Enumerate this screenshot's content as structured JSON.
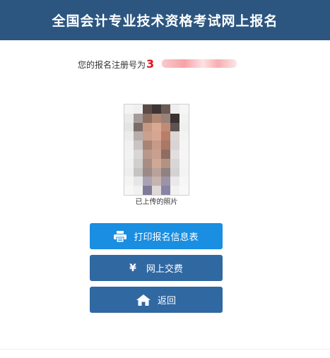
{
  "header": {
    "title": "全国会计专业技术资格考试网上报名"
  },
  "registration": {
    "label": "您的报名注册号为",
    "number": "3"
  },
  "photo": {
    "caption": "已上传的照片"
  },
  "actions": {
    "print_label": "打印报名信息表",
    "pay_label": "网上交费",
    "pay_symbol": "¥",
    "back_label": "返回"
  },
  "colors": {
    "header_bg": "#2c5680",
    "primary_button": "#1a8ee0",
    "secondary_button": "#3068a2",
    "reg_number": "#e0141e"
  }
}
